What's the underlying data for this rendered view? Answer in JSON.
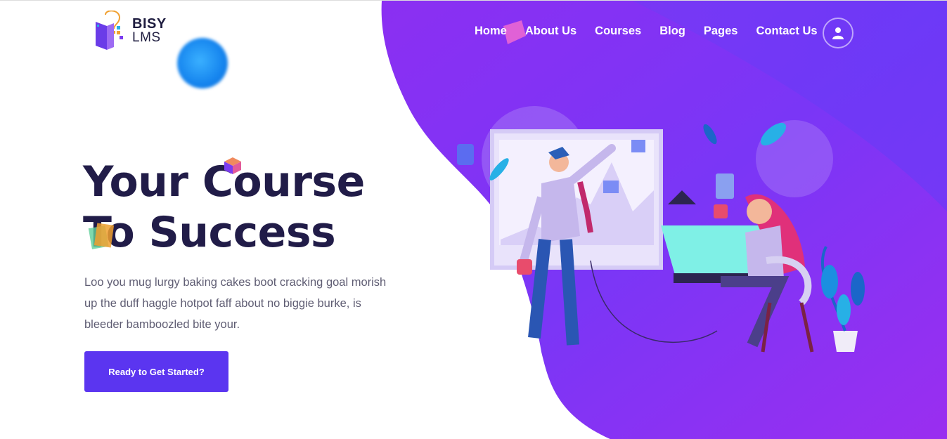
{
  "brand": {
    "name_top": "BISY",
    "name_bottom": "LMS"
  },
  "nav": {
    "items": [
      {
        "label": "Home"
      },
      {
        "label": "About Us"
      },
      {
        "label": "Courses"
      },
      {
        "label": "Blog"
      },
      {
        "label": "Pages"
      },
      {
        "label": "Contact Us"
      }
    ]
  },
  "hero": {
    "title_line1": "Your Course",
    "title_line2": "To Success",
    "description": "Loo you mug lurgy baking cakes boot cracking goal morish up the duff haggle hotpot faff about no biggie burke, is bleeder bamboozled bite your.",
    "cta_label": "Ready to Get Started?"
  },
  "colors": {
    "accent": "#5b35f0",
    "purple": "#7b2ff0",
    "title": "#211c48"
  },
  "icons": {
    "user": "user-icon",
    "logo": "bulb-book-logo"
  }
}
